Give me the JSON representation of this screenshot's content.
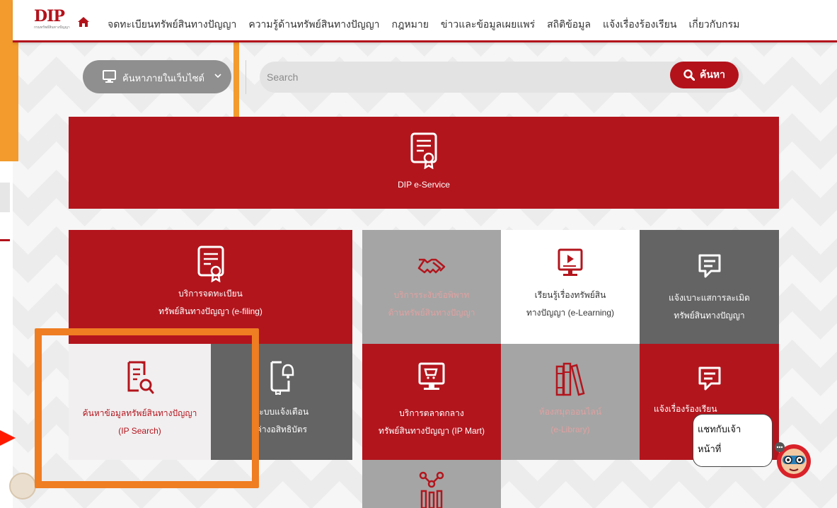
{
  "header": {
    "logo_text": "DIP",
    "logo_subtitle": "กรมทรัพย์สินทางปัญญา",
    "nav": [
      "จดทะเบียนทรัพย์สินทางปัญญา",
      "ความรู้ด้านทรัพย์สินทางปัญญา",
      "กฎหมาย",
      "ข่าวและข้อมูลเผยแพร่",
      "สถิติข้อมูล",
      "แจ้งเรื่องร้องเรียน",
      "เกี่ยวกับกรม"
    ]
  },
  "search": {
    "category_label": "ค้นหาภายในเว็บไซต์",
    "placeholder": "Search",
    "button_label": "ค้นหา"
  },
  "tiles": {
    "eservice": {
      "label": "DIP e-Service"
    },
    "efiling": {
      "line1": "บริการจดทะเบียน",
      "line2": "ทรัพย์สินทางปัญญา (e-filing)"
    },
    "dispute": {
      "line1": "บริการระงับข้อพิพาท",
      "line2": "ด้านทรัพย์สินทางปัญญา"
    },
    "elearning": {
      "line1": "เรียนรู้เรื่องทรัพย์สิน",
      "line2": "ทางปัญญา (e-Learning)"
    },
    "report": {
      "line1": "แจ้งเบาะแสการละเมิด",
      "line2": "ทรัพย์สินทางปัญญา"
    },
    "ipsearch": {
      "line1": "ค้นหาข้อมูลทรัพย์สินทางปัญญา",
      "line2": "(IP Search)"
    },
    "alert": {
      "line1": "ระบบแจ้งเตือน",
      "line2": "ค่างอสิทธิบัตร"
    },
    "ipmart": {
      "line1": "บริการตลาดกลาง",
      "line2": "ทรัพย์สินทางปัญญา (IP Mart)"
    },
    "library": {
      "line1": "ห้องสมุดออนไลน์",
      "line2": "(e-Library)"
    },
    "complaint": {
      "line1": "แจ้งเรื่องร้องเรียน"
    }
  },
  "chat": {
    "line1": "แชทกับเจ้า",
    "line2": "หน้าที่"
  },
  "colors": {
    "brand_red": "#b3151d",
    "highlight_orange": "#ef7d22",
    "arrow_red": "#ff1a00"
  }
}
